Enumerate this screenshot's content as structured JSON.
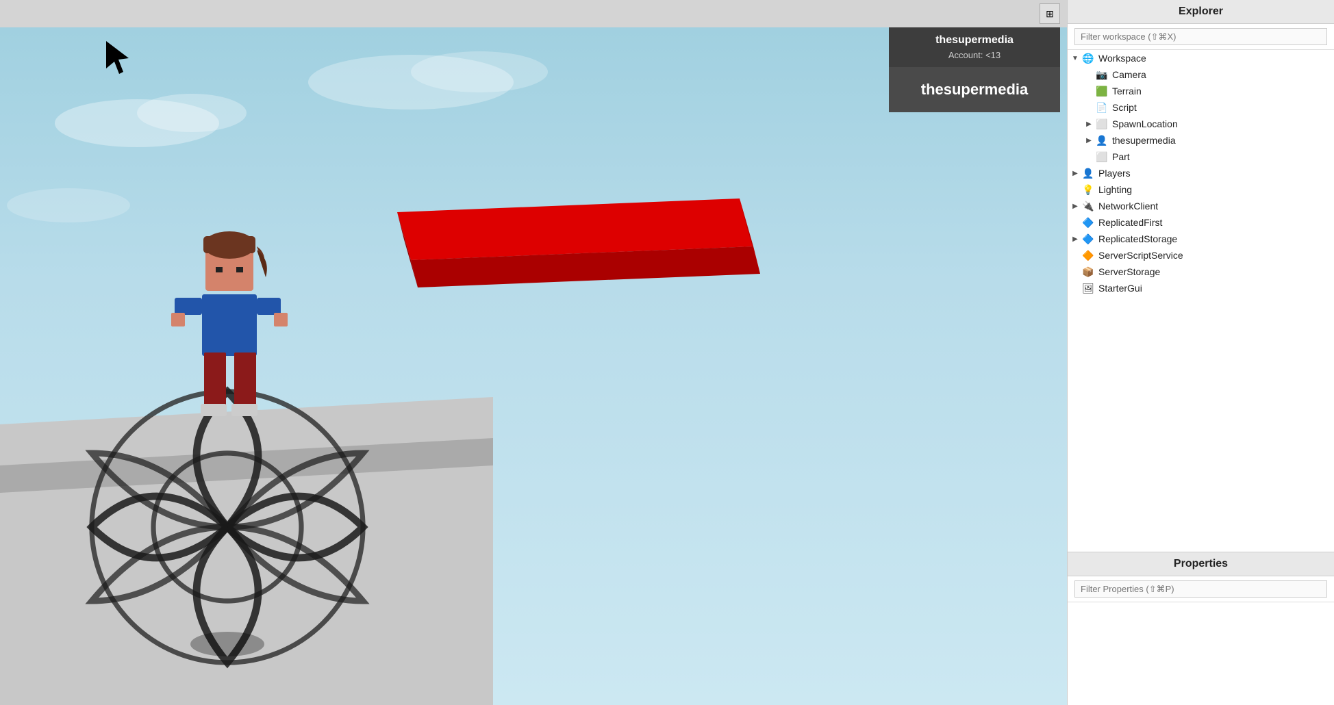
{
  "topbar": {
    "icon_label": "⊞"
  },
  "user_popup": {
    "username": "thesupermedia",
    "account_label": "Account: <13",
    "display_name": "thesupermedia"
  },
  "explorer": {
    "title": "Explorer",
    "filter_placeholder": "Filter workspace (⇧⌘X)",
    "tree": [
      {
        "id": "workspace",
        "label": "Workspace",
        "icon": "globe",
        "indent": 0,
        "arrow": "expanded"
      },
      {
        "id": "camera",
        "label": "Camera",
        "icon": "camera",
        "indent": 1,
        "arrow": "empty"
      },
      {
        "id": "terrain",
        "label": "Terrain",
        "icon": "terrain",
        "indent": 1,
        "arrow": "empty"
      },
      {
        "id": "script",
        "label": "Script",
        "icon": "script",
        "indent": 1,
        "arrow": "empty"
      },
      {
        "id": "spawnlocation",
        "label": "SpawnLocation",
        "icon": "spawn",
        "indent": 1,
        "arrow": "collapsed"
      },
      {
        "id": "thesupermedia",
        "label": "thesupermedia",
        "icon": "player",
        "indent": 1,
        "arrow": "collapsed"
      },
      {
        "id": "part",
        "label": "Part",
        "icon": "part",
        "indent": 1,
        "arrow": "empty"
      },
      {
        "id": "players",
        "label": "Players",
        "icon": "player",
        "indent": 0,
        "arrow": "collapsed"
      },
      {
        "id": "lighting",
        "label": "Lighting",
        "icon": "lighting",
        "indent": 0,
        "arrow": "empty"
      },
      {
        "id": "networkclient",
        "label": "NetworkClient",
        "icon": "network",
        "indent": 0,
        "arrow": "collapsed"
      },
      {
        "id": "replicatedfirst",
        "label": "ReplicatedFirst",
        "icon": "replicated",
        "indent": 0,
        "arrow": "empty"
      },
      {
        "id": "replicatedstorage",
        "label": "ReplicatedStorage",
        "icon": "replicated",
        "indent": 0,
        "arrow": "collapsed"
      },
      {
        "id": "serverscriptservice",
        "label": "ServerScriptService",
        "icon": "server",
        "indent": 0,
        "arrow": "empty"
      },
      {
        "id": "serverstorage",
        "label": "ServerStorage",
        "icon": "storage",
        "indent": 0,
        "arrow": "empty"
      },
      {
        "id": "startergui",
        "label": "StarterGui",
        "icon": "gui",
        "indent": 0,
        "arrow": "empty"
      }
    ]
  },
  "properties": {
    "title": "Properties",
    "filter_placeholder": "Filter Properties (⇧⌘P)"
  }
}
